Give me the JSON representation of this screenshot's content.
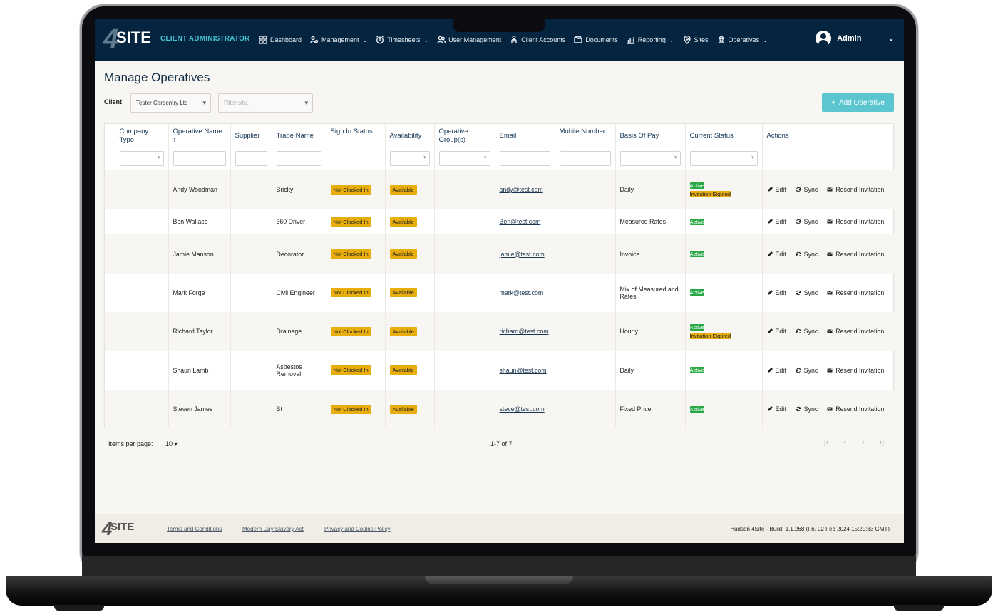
{
  "app": {
    "logo_number": "4",
    "logo_text": "SITE",
    "title": "CLIENT ADMINISTRATOR"
  },
  "nav": {
    "items": [
      {
        "label": "Dashboard",
        "icon": "dashboard-icon",
        "has_dropdown": false
      },
      {
        "label": "Management",
        "icon": "management-icon",
        "has_dropdown": true
      },
      {
        "label": "Timesheets",
        "icon": "clock-icon",
        "has_dropdown": true
      },
      {
        "label": "User Management",
        "icon": "users-icon",
        "has_dropdown": false
      },
      {
        "label": "Client Accounts",
        "icon": "client-accounts-icon",
        "has_dropdown": false
      },
      {
        "label": "Documents",
        "icon": "documents-icon",
        "has_dropdown": false
      },
      {
        "label": "Reporting",
        "icon": "bar-chart-icon",
        "has_dropdown": true
      },
      {
        "label": "Sites",
        "icon": "location-pin-icon",
        "has_dropdown": false
      },
      {
        "label": "Operatives",
        "icon": "worker-icon",
        "has_dropdown": true
      }
    ],
    "chevron": "⌄",
    "user": {
      "name": "Admin",
      "chevron": "⌄"
    }
  },
  "page": {
    "title": "Manage Operatives",
    "client_label": "Client",
    "client_select": "Tester Carpentry Ltd",
    "site_placeholder": "Filter site..",
    "add_button": "Add Operative",
    "add_icon": "+"
  },
  "table": {
    "columns": [
      {
        "label": "",
        "filter": "none"
      },
      {
        "label": "Company Type",
        "filter": "dropdown"
      },
      {
        "label": "Operative Name",
        "sort": "↑",
        "filter": "text"
      },
      {
        "label": "Supplier",
        "filter": "text"
      },
      {
        "label": "Trade Name",
        "filter": "text"
      },
      {
        "label": "Sign In Status",
        "filter": "none"
      },
      {
        "label": "Availability",
        "filter": "dropdown"
      },
      {
        "label": "Operative Group(s)",
        "filter": "dropdown"
      },
      {
        "label": "Email",
        "filter": "text"
      },
      {
        "label": "Mobile Number",
        "filter": "text"
      },
      {
        "label": "Basis Of Pay",
        "filter": "dropdown"
      },
      {
        "label": "Current Status",
        "filter": "dropdown"
      },
      {
        "label": "Actions",
        "filter": "none"
      }
    ],
    "rows": [
      {
        "company_type": "",
        "name": "Andy Woodman",
        "supplier": "",
        "trade": "Bricky",
        "sign_in": "Not Clocked In",
        "availability": "Available",
        "groups": "",
        "email": "andy@test.com",
        "mobile": "",
        "basis_of_pay": "Daily",
        "status": [
          "Active",
          "Invitation Expired"
        ]
      },
      {
        "company_type": "",
        "name": "Ben Wallace",
        "supplier": "",
        "trade": "360 Driver",
        "sign_in": "Not Clocked In",
        "availability": "Available",
        "groups": "",
        "email": "Ben@test.com",
        "mobile": "",
        "basis_of_pay": "Measured Rates",
        "status": [
          "Active"
        ]
      },
      {
        "company_type": "",
        "name": "Jamie Manson",
        "supplier": "",
        "trade": "Decorator",
        "sign_in": "Not Clocked In",
        "availability": "Available",
        "groups": "",
        "email": "jamie@test.com",
        "mobile": "",
        "basis_of_pay": "Invoice",
        "status": [
          "Active"
        ]
      },
      {
        "company_type": "",
        "name": "Mark Forge",
        "supplier": "",
        "trade": "Civil Engineer",
        "sign_in": "Not Clocked In",
        "availability": "Available",
        "groups": "",
        "email": "mark@test.com",
        "mobile": "",
        "basis_of_pay": "Mix of Measured and Rates",
        "status": [
          "Active"
        ]
      },
      {
        "company_type": "",
        "name": "Richard Taylor",
        "supplier": "",
        "trade": "Drainage",
        "sign_in": "Not Clocked In",
        "availability": "Available",
        "groups": "",
        "email": "richard@test.com",
        "mobile": "",
        "basis_of_pay": "Hourly",
        "status": [
          "Active",
          "Invitation Expired"
        ]
      },
      {
        "company_type": "",
        "name": "Shaun Lamb",
        "supplier": "",
        "trade": "Asbestos Removal",
        "sign_in": "Not Clocked In",
        "availability": "Available",
        "groups": "",
        "email": "shaun@test.com",
        "mobile": "",
        "basis_of_pay": "Daily",
        "status": [
          "Active"
        ]
      },
      {
        "company_type": "",
        "name": "Steven James",
        "supplier": "",
        "trade": "Bt",
        "sign_in": "Not Clocked In",
        "availability": "Available",
        "groups": "",
        "email": "steve@test.com",
        "mobile": "",
        "basis_of_pay": "Fixed Price",
        "status": [
          "Active"
        ]
      }
    ],
    "actions": {
      "edit": "Edit",
      "sync": "Sync",
      "resend": "Resend Invitation"
    }
  },
  "pagination": {
    "items_per_page_label": "Items per page:",
    "items_per_page": "10",
    "range": "1-7 of 7",
    "first": "|‹",
    "prev": "‹",
    "next": "›",
    "last": "›|"
  },
  "footer": {
    "links": [
      "Terms and Conditions",
      "Modern Day Slavery Act",
      "Privacy and Cookie Policy"
    ],
    "build": "Hudson 4Site - Build: 1.1.268 (Fri, 02 Feb 2024 15:20:33 GMT)"
  },
  "colors": {
    "navbar": "#042440",
    "accent": "#45c2d0",
    "add_button": "#5bc6cf",
    "badge_yellow": "#e8ae0e",
    "badge_green": "#27a844"
  }
}
